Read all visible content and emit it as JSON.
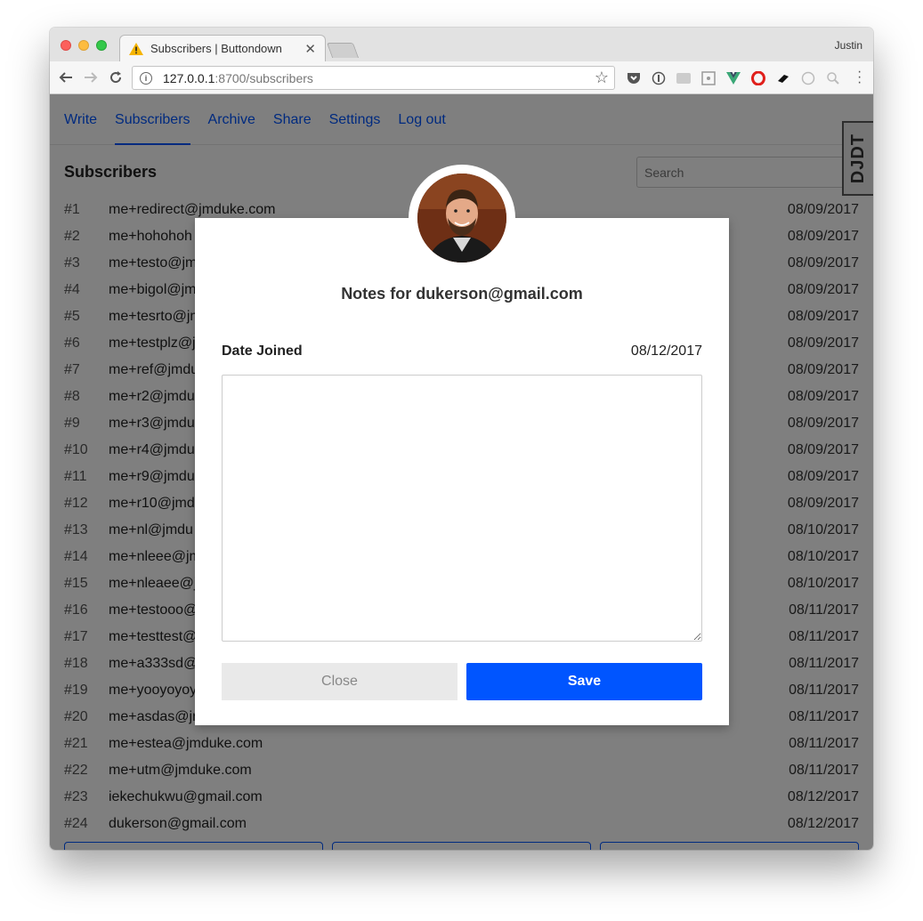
{
  "browser": {
    "tab_title": "Subscribers | Buttondown",
    "profile_name": "Justin",
    "url_host": "127.0.0.1",
    "url_rest": ":8700/subscribers"
  },
  "nav": {
    "items": [
      {
        "label": "Write",
        "active": false
      },
      {
        "label": "Subscribers",
        "active": true
      },
      {
        "label": "Archive",
        "active": false
      },
      {
        "label": "Share",
        "active": false
      },
      {
        "label": "Settings",
        "active": false
      },
      {
        "label": "Log out",
        "active": false
      }
    ]
  },
  "page": {
    "heading": "Subscribers",
    "search_placeholder": "Search"
  },
  "subscribers": [
    {
      "num": "#1",
      "email": "me+redirect@jmduke.com",
      "date": "08/09/2017"
    },
    {
      "num": "#2",
      "email": "me+hohohoh",
      "date": "08/09/2017"
    },
    {
      "num": "#3",
      "email": "me+testo@jm",
      "date": "08/09/2017"
    },
    {
      "num": "#4",
      "email": "me+bigol@jm",
      "date": "08/09/2017"
    },
    {
      "num": "#5",
      "email": "me+tesrto@jm",
      "date": "08/09/2017"
    },
    {
      "num": "#6",
      "email": "me+testplz@j",
      "date": "08/09/2017"
    },
    {
      "num": "#7",
      "email": "me+ref@jmdu",
      "date": "08/09/2017"
    },
    {
      "num": "#8",
      "email": "me+r2@jmdu",
      "date": "08/09/2017"
    },
    {
      "num": "#9",
      "email": "me+r3@jmdu",
      "date": "08/09/2017"
    },
    {
      "num": "#10",
      "email": "me+r4@jmdu",
      "date": "08/09/2017"
    },
    {
      "num": "#11",
      "email": "me+r9@jmdu",
      "date": "08/09/2017"
    },
    {
      "num": "#12",
      "email": "me+r10@jmd",
      "date": "08/09/2017"
    },
    {
      "num": "#13",
      "email": "me+nl@jmdu",
      "date": "08/10/2017"
    },
    {
      "num": "#14",
      "email": "me+nleee@jm",
      "date": "08/10/2017"
    },
    {
      "num": "#15",
      "email": "me+nleaee@j",
      "date": "08/10/2017"
    },
    {
      "num": "#16",
      "email": "me+testooo@",
      "date": "08/11/2017"
    },
    {
      "num": "#17",
      "email": "me+testtest@",
      "date": "08/11/2017"
    },
    {
      "num": "#18",
      "email": "me+a333sd@",
      "date": "08/11/2017"
    },
    {
      "num": "#19",
      "email": "me+yooyoyoy",
      "date": "08/11/2017"
    },
    {
      "num": "#20",
      "email": "me+asdas@jr",
      "date": "08/11/2017"
    },
    {
      "num": "#21",
      "email": "me+estea@jmduke.com",
      "date": "08/11/2017"
    },
    {
      "num": "#22",
      "email": "me+utm@jmduke.com",
      "date": "08/11/2017"
    },
    {
      "num": "#23",
      "email": "iekechukwu@gmail.com",
      "date": "08/12/2017"
    },
    {
      "num": "#24",
      "email": "dukerson@gmail.com",
      "date": "08/12/2017"
    }
  ],
  "djdt_label": "DJDT",
  "modal": {
    "title": "Notes for dukerson@gmail.com",
    "date_label": "Date Joined",
    "date_value": "08/12/2017",
    "notes_value": "",
    "close_label": "Close",
    "save_label": "Save"
  },
  "colors": {
    "accent": "#0055ff",
    "overlay": "rgba(0,0,0,0.5)"
  }
}
